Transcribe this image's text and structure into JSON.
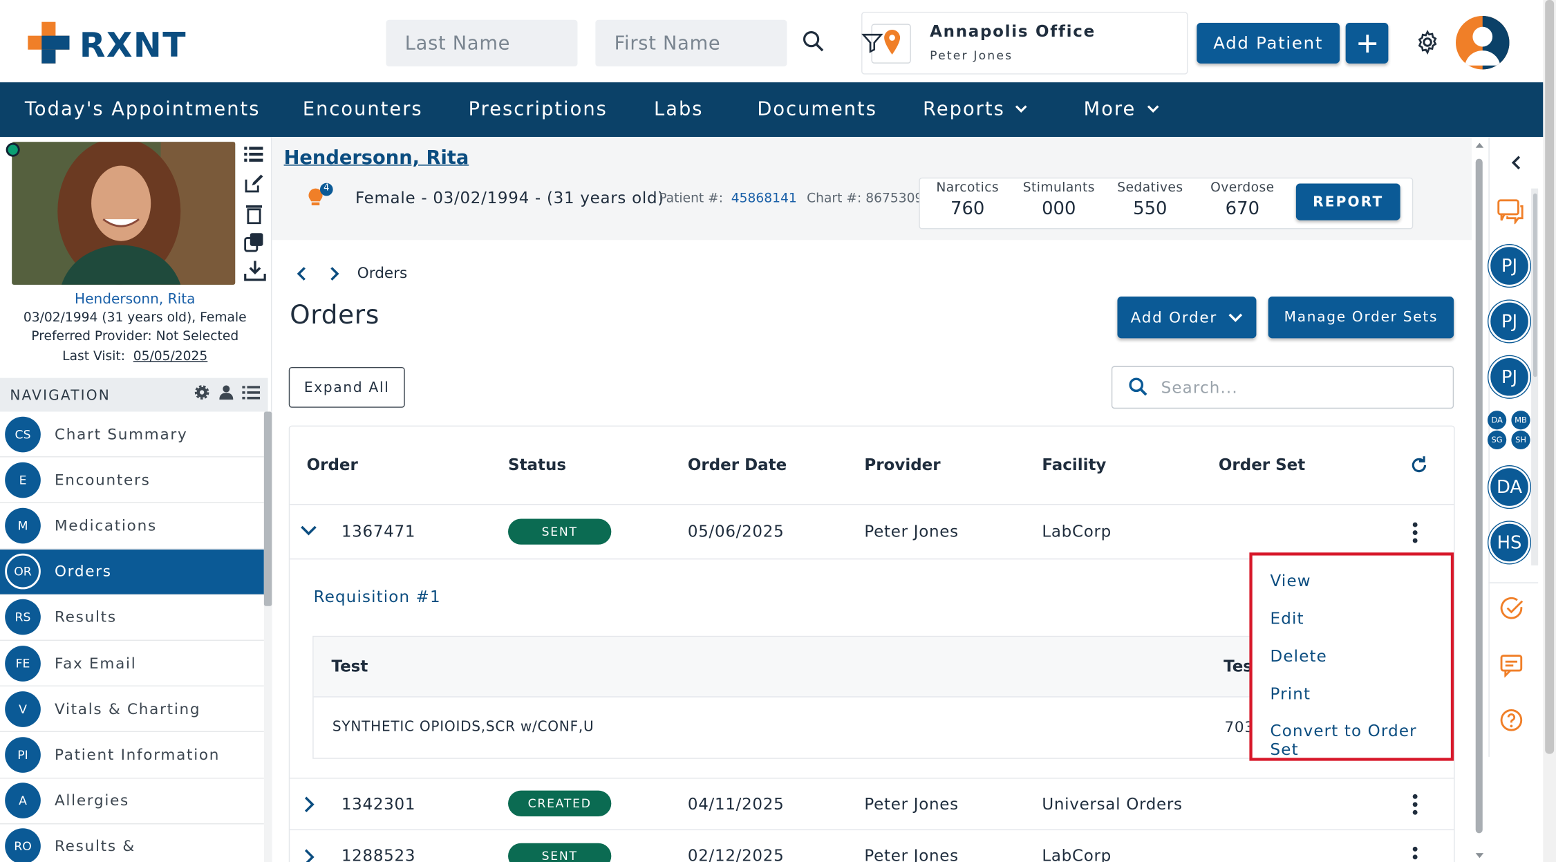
{
  "brand": {
    "name": "RXNT"
  },
  "header": {
    "last_name_placeholder": "Last Name",
    "first_name_placeholder": "First Name",
    "office_name": "Annapolis Office",
    "office_user": "Peter Jones",
    "add_patient_label": "Add Patient"
  },
  "nav": {
    "items": [
      "Today's Appointments",
      "Encounters",
      "Prescriptions",
      "Labs",
      "Documents",
      "Reports",
      "More"
    ]
  },
  "patient": {
    "name": "Hendersonn, Rita",
    "dob_line": "03/02/1994 (31 years old), Female",
    "provider_line": "Preferred Provider: Not Selected",
    "last_visit_label": "Last Visit:",
    "last_visit_date": "05/05/2025",
    "demographics": "Female - 03/02/1994 - (31 years old)",
    "alert_count": "4",
    "patient_num_label": "Patient #:",
    "patient_num": "45868141",
    "chart_num": "Chart #: 8675309"
  },
  "stats": [
    {
      "label": "Narcotics",
      "value": "760"
    },
    {
      "label": "Stimulants",
      "value": "000"
    },
    {
      "label": "Sedatives",
      "value": "550"
    },
    {
      "label": "Overdose",
      "value": "670"
    }
  ],
  "report_label": "REPORT",
  "sidebar": {
    "heading": "NAVIGATION",
    "items": [
      {
        "abbr": "CS",
        "label": "Chart Summary"
      },
      {
        "abbr": "E",
        "label": "Encounters"
      },
      {
        "abbr": "M",
        "label": "Medications"
      },
      {
        "abbr": "OR",
        "label": "Orders"
      },
      {
        "abbr": "RS",
        "label": "Results"
      },
      {
        "abbr": "FE",
        "label": "Fax Email"
      },
      {
        "abbr": "V",
        "label": "Vitals & Charting"
      },
      {
        "abbr": "PI",
        "label": "Patient Information"
      },
      {
        "abbr": "A",
        "label": "Allergies"
      },
      {
        "abbr": "RO",
        "label": "Results &"
      }
    ],
    "active_index": 3
  },
  "main": {
    "breadcrumb": "Orders",
    "title": "Orders",
    "add_order_label": "Add Order",
    "manage_sets_label": "Manage Order Sets",
    "expand_all_label": "Expand All",
    "search_placeholder": "Search...",
    "columns": [
      "Order",
      "Status",
      "Order Date",
      "Provider",
      "Facility",
      "Order Set"
    ],
    "orders": [
      {
        "id": "1367471",
        "status": "SENT",
        "date": "05/06/2025",
        "provider": "Peter Jones",
        "facility": "LabCorp",
        "order_set": ""
      },
      {
        "id": "1342301",
        "status": "CREATED",
        "date": "04/11/2025",
        "provider": "Peter Jones",
        "facility": "Universal Orders",
        "order_set": ""
      },
      {
        "id": "1288523",
        "status": "SENT",
        "date": "02/12/2025",
        "provider": "Peter Jones",
        "facility": "LabCorp",
        "order_set": ""
      }
    ],
    "requisition": {
      "title": "Requisition #1",
      "test_header": "Test",
      "test_header_2": "Tes",
      "test_name": "SYNTHETIC OPIOIDS,SCR w/CONF,U",
      "test_code": "703"
    }
  },
  "context_menu": [
    "View",
    "Edit",
    "Delete",
    "Print",
    "Convert to Order Set"
  ],
  "rail": {
    "avatars": [
      "PJ",
      "PJ",
      "PJ"
    ],
    "mini": [
      "DA",
      "MB",
      "SG",
      "SH"
    ],
    "avatars2": [
      "DA",
      "HS"
    ]
  },
  "colors": {
    "primary": "#0b5a96",
    "navbar": "#0b4168",
    "accent_orange": "#f07f28",
    "status_green": "#0b6b52",
    "highlight_red": "#d7182a"
  }
}
